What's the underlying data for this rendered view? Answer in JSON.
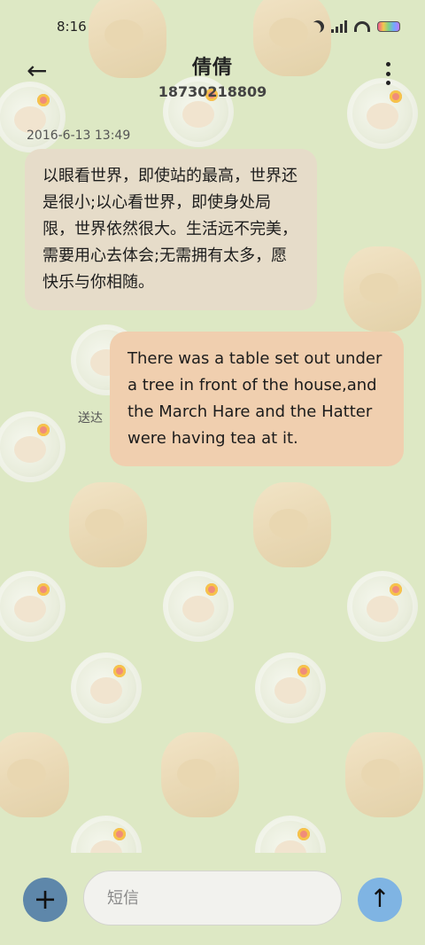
{
  "status_bar": {
    "time": "8:16",
    "icons": [
      "moon-icon",
      "signal-icon",
      "wifi-icon",
      "battery-icon"
    ]
  },
  "header": {
    "back_icon": "back-arrow-icon",
    "contact_name": "倩倩",
    "contact_number": "18730218809",
    "more_icon": "more-vertical-icon"
  },
  "conversation": {
    "timestamp": "2016-6-13 13:49",
    "messages": [
      {
        "direction": "incoming",
        "text": "以眼看世界，即使站的最高，世界还是很小;以心看世界，即使身处局限，世界依然很大。生活远不完美，需要用心去体会;无需拥有太多，愿快乐与你相随。"
      },
      {
        "direction": "outgoing",
        "text": "There was a table set out under a tree in front of the house,and the March Hare and the Hatter were having tea at it.",
        "status": "送达"
      }
    ]
  },
  "composer": {
    "add_label": "+",
    "placeholder": "短信",
    "send_label": "↑"
  },
  "colors": {
    "background": "#dde8c4",
    "incoming_bubble": "#e6dcc9",
    "outgoing_bubble": "#f0cfaf",
    "add_button": "#5e87aa",
    "send_button": "#7fb4e3"
  }
}
